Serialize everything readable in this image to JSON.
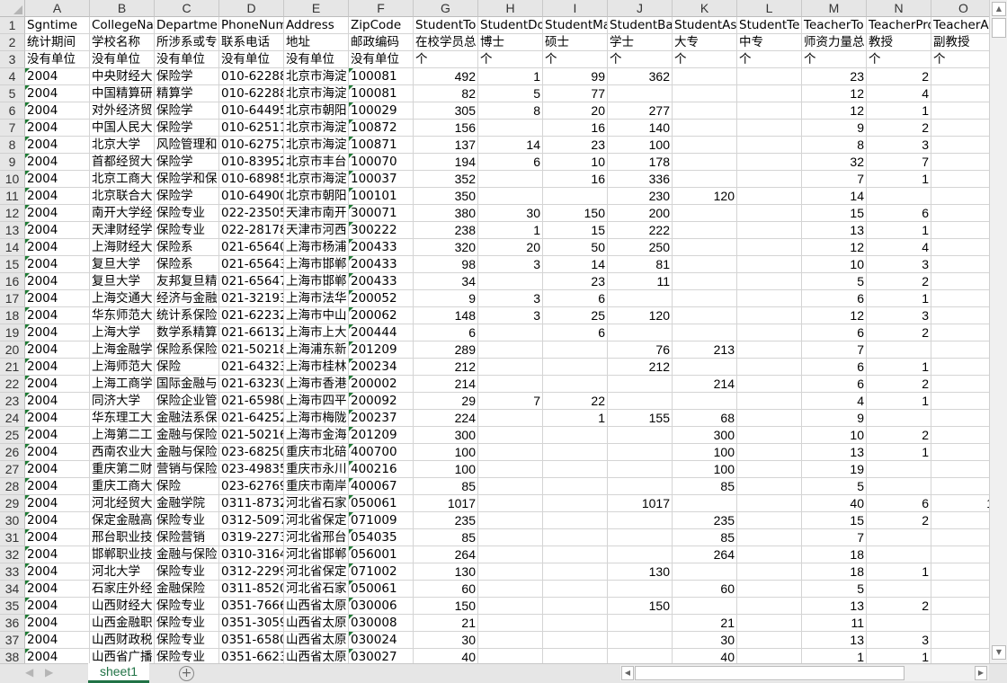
{
  "columns": [
    "A",
    "B",
    "C",
    "D",
    "E",
    "F",
    "G",
    "H",
    "I",
    "J",
    "K",
    "L",
    "M",
    "N",
    "O"
  ],
  "header_rows": [
    [
      "Sgntime",
      "CollegeNa",
      "Departmen",
      "PhoneNum",
      "Address",
      "ZipCode",
      "StudentTo",
      "StudentDo",
      "StudentMa",
      "StudentBa",
      "StudentAs",
      "StudentTe",
      "TeacherTo",
      "TeacherPro",
      "TeacherA"
    ],
    [
      "统计期间",
      "学校名称",
      "所涉系或专",
      "联系电话",
      "地址",
      "邮政编码",
      "在校学员总",
      "博士",
      "硕士",
      "学士",
      "大专",
      "中专",
      "师资力量总",
      "教授",
      "副教授"
    ],
    [
      "没有单位",
      "没有单位",
      "没有单位",
      "没有单位",
      "没有单位",
      "没有单位",
      "个",
      "个",
      "个",
      "个",
      "个",
      "个",
      "个",
      "个",
      "个"
    ]
  ],
  "rows": [
    [
      "2004",
      "中央财经大",
      "保险学",
      "010-62288",
      "北京市海淀",
      "100081",
      "492",
      "1",
      "99",
      "362",
      "",
      "",
      "23",
      "2",
      ""
    ],
    [
      "2004",
      "中国精算研",
      "精算学",
      "010-62288",
      "北京市海淀",
      "100081",
      "82",
      "5",
      "77",
      "",
      "",
      "",
      "12",
      "4",
      ""
    ],
    [
      "2004",
      "对外经济贸",
      "保险学",
      "010-64495",
      "北京市朝阳",
      "100029",
      "305",
      "8",
      "20",
      "277",
      "",
      "",
      "12",
      "1",
      ""
    ],
    [
      "2004",
      "中国人民大",
      "保险学",
      "010-62511",
      "北京市海淀",
      "100872",
      "156",
      "",
      "16",
      "140",
      "",
      "",
      "9",
      "2",
      ""
    ],
    [
      "2004",
      "北京大学",
      "风险管理和",
      "010-62757",
      "北京市海淀",
      "100871",
      "137",
      "14",
      "23",
      "100",
      "",
      "",
      "8",
      "3",
      ""
    ],
    [
      "2004",
      "首都经贸大",
      "保险学",
      "010-83952",
      "北京市丰台",
      "100070",
      "194",
      "6",
      "10",
      "178",
      "",
      "",
      "32",
      "7",
      ""
    ],
    [
      "2004",
      "北京工商大",
      "保险学和保",
      "010-68985",
      "北京市海淀",
      "100037",
      "352",
      "",
      "16",
      "336",
      "",
      "",
      "7",
      "1",
      ""
    ],
    [
      "2004",
      "北京联合大",
      "保险学",
      "010-64900",
      "北京市朝阳",
      "100101",
      "350",
      "",
      "",
      "230",
      "120",
      "",
      "14",
      "",
      ""
    ],
    [
      "2004",
      "南开大学经",
      "保险专业",
      "022-23505",
      "天津市南开",
      "300071",
      "380",
      "30",
      "150",
      "200",
      "",
      "",
      "15",
      "6",
      ""
    ],
    [
      "2004",
      "天津财经学",
      "保险专业",
      "022-28178",
      "天津市河西",
      "300222",
      "238",
      "1",
      "15",
      "222",
      "",
      "",
      "13",
      "1",
      ""
    ],
    [
      "2004",
      "上海财经大",
      "保险系",
      "021-65640",
      "上海市杨浦",
      "200433",
      "320",
      "20",
      "50",
      "250",
      "",
      "",
      "12",
      "4",
      ""
    ],
    [
      "2004",
      "复旦大学",
      "保险系",
      "021-65643",
      "上海市邯郸",
      "200433",
      "98",
      "3",
      "14",
      "81",
      "",
      "",
      "10",
      "3",
      ""
    ],
    [
      "2004",
      "复旦大学",
      "友邦复旦精",
      "021-65647",
      "上海市邯郸",
      "200433",
      "34",
      "",
      "23",
      "11",
      "",
      "",
      "5",
      "2",
      ""
    ],
    [
      "2004",
      "上海交通大",
      "经济与金融",
      "021-32193",
      "上海市法华",
      "200052",
      "9",
      "3",
      "6",
      "",
      "",
      "",
      "6",
      "1",
      ""
    ],
    [
      "2004",
      "华东师范大",
      "统计系保险",
      "021-62232",
      "上海市中山",
      "200062",
      "148",
      "3",
      "25",
      "120",
      "",
      "",
      "12",
      "3",
      ""
    ],
    [
      "2004",
      "上海大学",
      "数学系精算",
      "021-66132",
      "上海市上大",
      "200444",
      "6",
      "",
      "6",
      "",
      "",
      "",
      "6",
      "2",
      ""
    ],
    [
      "2004",
      "上海金融学",
      "保险系保险",
      "021-50218",
      "上海浦东新",
      "201209",
      "289",
      "",
      "",
      "76",
      "213",
      "",
      "7",
      "",
      ""
    ],
    [
      "2004",
      "上海师范大",
      "保险",
      "021-64323",
      "上海市桂林",
      "200234",
      "212",
      "",
      "",
      "212",
      "",
      "",
      "6",
      "1",
      ""
    ],
    [
      "2004",
      "上海工商学",
      "国际金融与",
      "021-63230",
      "上海市香港",
      "200002",
      "214",
      "",
      "",
      "",
      "214",
      "",
      "6",
      "2",
      ""
    ],
    [
      "2004",
      "同济大学",
      "保险企业管",
      "021-65980",
      "上海市四平",
      "200092",
      "29",
      "7",
      "22",
      "",
      "",
      "",
      "4",
      "1",
      ""
    ],
    [
      "2004",
      "华东理工大",
      "金融法系保",
      "021-64252",
      "上海市梅陇",
      "200237",
      "224",
      "",
      "1",
      "155",
      "68",
      "",
      "9",
      "",
      ""
    ],
    [
      "2004",
      "上海第二工",
      "金融与保险",
      "021-50216",
      "上海市金海",
      "201209",
      "300",
      "",
      "",
      "",
      "300",
      "",
      "10",
      "2",
      ""
    ],
    [
      "2004",
      "西南农业大",
      "金融与保险",
      "023-68250",
      "重庆市北碚",
      "400700",
      "100",
      "",
      "",
      "",
      "100",
      "",
      "13",
      "1",
      ""
    ],
    [
      "2004",
      "重庆第二财",
      "营销与保险",
      "023-49835",
      "重庆市永川",
      "400216",
      "100",
      "",
      "",
      "",
      "100",
      "",
      "19",
      "",
      ""
    ],
    [
      "2004",
      "重庆工商大",
      "保险",
      "023-62769",
      "重庆市南岸",
      "400067",
      "85",
      "",
      "",
      "",
      "85",
      "",
      "5",
      "",
      ""
    ],
    [
      "2004",
      "河北经贸大",
      "金融学院",
      "0311-8732",
      "河北省石家",
      "050061",
      "1017",
      "",
      "",
      "1017",
      "",
      "",
      "40",
      "6",
      "1"
    ],
    [
      "2004",
      "保定金融高",
      "保险专业",
      "0312-5097",
      "河北省保定",
      "071009",
      "235",
      "",
      "",
      "",
      "235",
      "",
      "15",
      "2",
      ""
    ],
    [
      "2004",
      "邢台职业技",
      "保险营销",
      "0319-2273",
      "河北省邢台",
      "054035",
      "85",
      "",
      "",
      "",
      "85",
      "",
      "7",
      "",
      ""
    ],
    [
      "2004",
      "邯郸职业技",
      "金融与保险",
      "0310-3164",
      "河北省邯郸",
      "056001",
      "264",
      "",
      "",
      "",
      "264",
      "",
      "18",
      "",
      ""
    ],
    [
      "2004",
      "河北大学",
      "保险专业",
      "0312-2299",
      "河北省保定",
      "071002",
      "130",
      "",
      "",
      "130",
      "",
      "",
      "18",
      "1",
      ""
    ],
    [
      "2004",
      "石家庄外经",
      "金融保险",
      "0311-8520",
      "河北省石家",
      "050061",
      "60",
      "",
      "",
      "",
      "60",
      "",
      "5",
      "",
      ""
    ],
    [
      "2004",
      "山西财经大",
      "保险专业",
      "0351-7666",
      "山西省太原",
      "030006",
      "150",
      "",
      "",
      "150",
      "",
      "",
      "13",
      "2",
      ""
    ],
    [
      "2004",
      "山西金融职",
      "保险专业",
      "0351-3059",
      "山西省太原",
      "030008",
      "21",
      "",
      "",
      "",
      "21",
      "",
      "11",
      "",
      ""
    ],
    [
      "2004",
      "山西财政税",
      "保险专业",
      "0351-6580",
      "山西省太原",
      "030024",
      "30",
      "",
      "",
      "",
      "30",
      "",
      "13",
      "3",
      ""
    ],
    [
      "2004",
      "山西省广播",
      "保险专业",
      "0351-6623",
      "山西省太原",
      "030027",
      "40",
      "",
      "",
      "",
      "40",
      "",
      "1",
      "1",
      ""
    ]
  ],
  "sheet_tabs": [
    "sheet1"
  ],
  "add_sheet_icon": "plus-circle-icon",
  "accent_color": "#217346"
}
